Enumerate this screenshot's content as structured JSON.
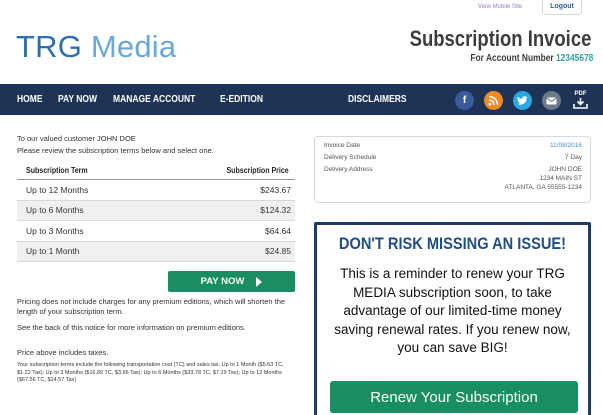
{
  "top": {
    "view_mobile": "View Mobile Site",
    "logout": "Logout"
  },
  "brand": {
    "trg": "TRG",
    "media": " Media"
  },
  "invoice": {
    "title": "Subscription Invoice",
    "account_prefix": "For Account Number ",
    "account_number": "12345678"
  },
  "nav": {
    "items": [
      "HOME",
      "PAY NOW",
      "MANAGE ACCOUNT",
      "E-EDITION"
    ],
    "disclaimers": "DISCLAIMERS",
    "icons": [
      "facebook-icon",
      "rss-icon",
      "twitter-icon",
      "mail-icon",
      "pdf-download-icon"
    ],
    "pdf_label": "PDF"
  },
  "intro": {
    "greeting": "To our valued customer JOHN DOE",
    "instruction": "Please review the subscription terms below and select one."
  },
  "terms": {
    "headers": [
      "Subscription Term",
      "Subscription Price"
    ],
    "rows": [
      {
        "term": "Up to 12 Months",
        "price": "$243.67"
      },
      {
        "term": "Up to 6 Months",
        "price": "$124.32"
      },
      {
        "term": "Up to 3 Months",
        "price": "$64.64"
      },
      {
        "term": "Up to 1 Month",
        "price": "$24.85"
      }
    ]
  },
  "pay_now": "PAY NOW",
  "notes": {
    "pricing": "Pricing does not include charges for any premium editions, which will shorten the length of your subscription term.",
    "back": "See the back of this notice for more information on premium editions.",
    "taxes": "Price above includes taxes.",
    "fine": "Your subscription terms include the following transportation cost (TC) and sales tax. Up to 1 Month ($5.63 TC, $1.22 Tax); Up to 3 Months ($16.89 TC, $3.66 Tax); Up to 6 Months ($33.78 TC, $7.29 Tax); Up to 12 Months ($67.56 TC, $14.57 Tax)"
  },
  "invoice_box": {
    "invoice_date_label": "Invoice Date",
    "invoice_date": "11/08/2016",
    "schedule_label": "Delivery Schedule",
    "schedule": "7 Day",
    "address_label": "Delivery Address",
    "address_name": "JOHN DOE",
    "address_street": "1234 MAIN ST",
    "address_city": "ATLANTA, GA 55555-1234"
  },
  "reminder": {
    "headline": "DON'T RISK MISSING AN ISSUE!",
    "message": "This is a reminder to renew your TRG MEDIA subscription soon, to take advantage of our limited-time money saving renewal rates. If you renew now, you can save BIG!",
    "button": "Renew Your Subscription"
  },
  "colors": {
    "nav": "#1e3456",
    "accent_green": "#1a8e63",
    "brand_blue": "#2e6fb0",
    "headline_blue": "#1f4e86"
  }
}
